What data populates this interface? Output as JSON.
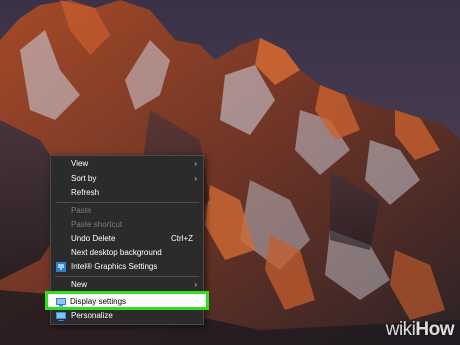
{
  "context_menu": {
    "items": [
      {
        "label": "View",
        "submenu": true
      },
      {
        "label": "Sort by",
        "submenu": true
      },
      {
        "label": "Refresh"
      },
      {
        "label": "Paste",
        "disabled": true
      },
      {
        "label": "Paste shortcut",
        "disabled": true
      },
      {
        "label": "Undo Delete",
        "shortcut": "Ctrl+Z"
      },
      {
        "label": "Next desktop background"
      },
      {
        "label": "Intel® Graphics Settings",
        "icon": "intel-graphics-icon"
      },
      {
        "label": "New",
        "submenu": true
      },
      {
        "label": "Display settings",
        "icon": "display-icon",
        "highlighted": true
      },
      {
        "label": "Personalize",
        "icon": "personalize-icon"
      }
    ],
    "arrow_glyph": "›"
  },
  "highlight_color": "#2fe01f",
  "watermark": {
    "wiki": "wiki",
    "how": "How"
  }
}
